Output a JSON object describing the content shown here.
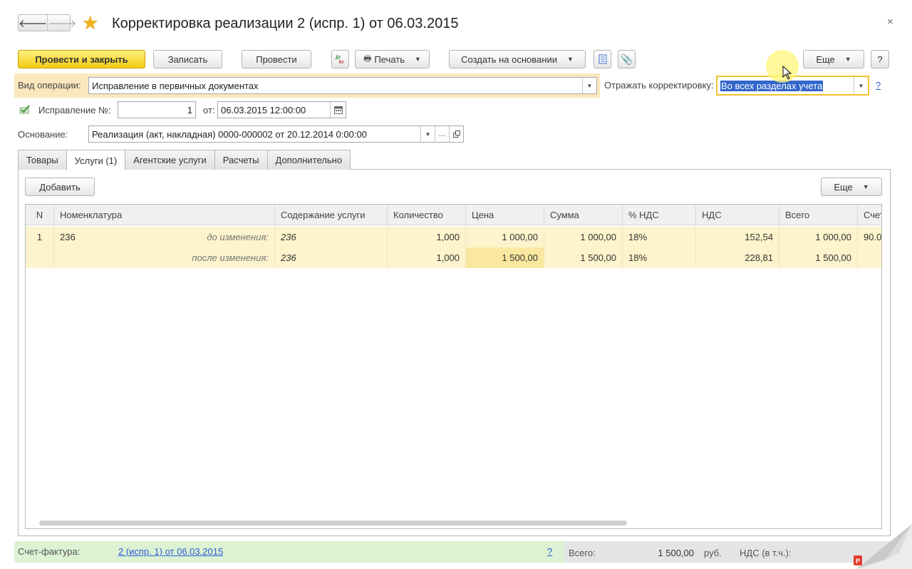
{
  "window": {
    "title": "Корректировка реализации 2 (испр. 1) от 06.03.2015",
    "back_icon": "arrow-left-icon",
    "forward_icon": "arrow-right-icon",
    "close": "×"
  },
  "toolbar": {
    "post_close": "Провести и закрыть",
    "save": "Записать",
    "post": "Провести",
    "dtkt": "Дт Кт",
    "print": "Печать",
    "create_based": "Создать на основании",
    "more": "Еще",
    "help": "?"
  },
  "form": {
    "operation_label": "Вид операции:",
    "operation_value": "Исправление в первичных документах",
    "reflect_label": "Отражать корректировку:",
    "reflect_value": "Во всех разделах учета",
    "reflect_help": "?",
    "correction_label": "Исправление №:",
    "correction_number": "1",
    "from_label": "от:",
    "from_date": "06.03.2015 12:00:00",
    "basis_label": "Основание:",
    "basis_value": "Реализация (акт, накладная) 0000-000002 от 20.12.2014 0:00:00",
    "basis_more": "..."
  },
  "tabs": [
    {
      "label": "Товары"
    },
    {
      "label": "Услуги (1)"
    },
    {
      "label": "Агентские услуги"
    },
    {
      "label": "Расчеты"
    },
    {
      "label": "Дополнительно"
    }
  ],
  "table_toolbar": {
    "add": "Добавить",
    "more": "Еще"
  },
  "table": {
    "columns": [
      "N",
      "Номенклатура",
      "",
      "Содержание услуги",
      "Количество",
      "Цена",
      "Сумма",
      "% НДС",
      "НДС",
      "Всего",
      "Счет"
    ],
    "rows": [
      [
        "1",
        "236",
        "до изменения:",
        "236",
        "1,000",
        "1 000,00",
        "1 000,00",
        "18%",
        "152,54",
        "1 000,00",
        "90.0"
      ],
      [
        "",
        "",
        "после изменения:",
        "236",
        "1,000",
        "1 500,00",
        "1 500,00",
        "18%",
        "228,81",
        "1 500,00",
        ""
      ]
    ]
  },
  "footer": {
    "invoice_label": "Счет-фактура:",
    "invoice_link": "2 (испр. 1) от 06.03.2015",
    "invoice_help": "?",
    "total_label": "Всего:",
    "total_value": "1 500,00",
    "currency": "руб.",
    "vat_label": "НДС (в т.ч.):"
  },
  "colors": {
    "primary_button": "#f4cc16",
    "operation_row_bg": "#fbe7bd",
    "data_row_bg": "#fdf3cc",
    "footer_green": "#ddf1d3",
    "link": "#2a5bd7"
  }
}
